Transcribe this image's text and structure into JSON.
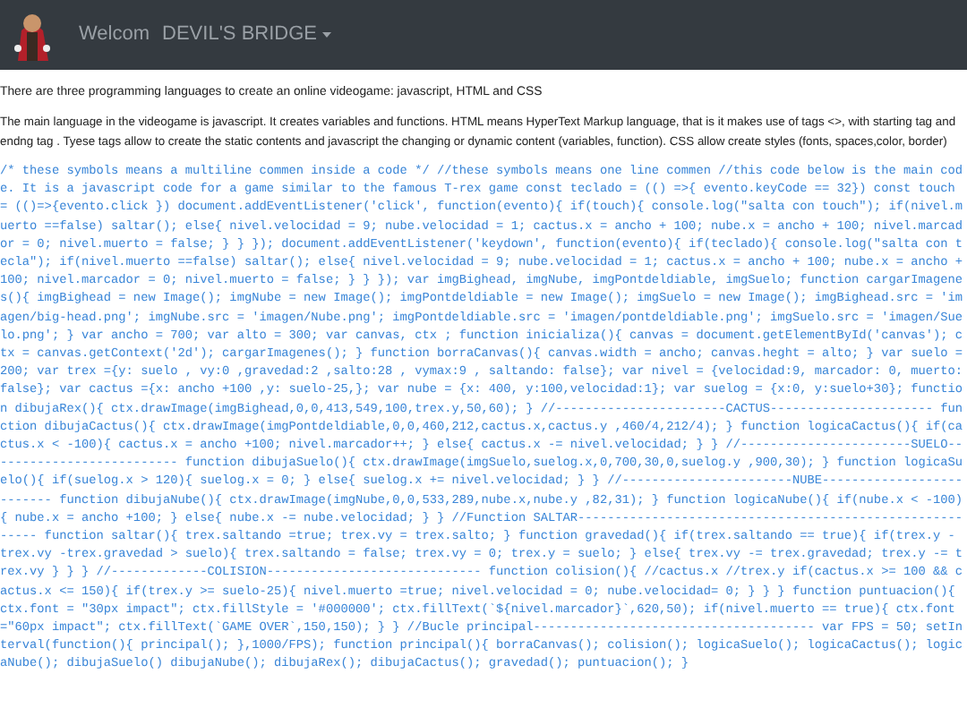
{
  "navbar": {
    "greeting": "Welcom",
    "menu_label": "DEVIL'S BRIDGE"
  },
  "intro": "There are three programming languages to create an online videogame: javascript, HTML and CSS",
  "description": "The main language in the videogame is javascript. It creates variables and functions. HTML means HyperText Markup language, that is it makes use of tags <>, with starting tag and endng tag . Tyese tags allow to create the static contents and javascript the changing or dynamic content (variables, function). CSS allow create styles (fonts, spaces,color, border)",
  "code": "/* these symbols means a multiline commen inside a code */ //these symbols means one line commen //this code below is the main code. It is a javascript code for a game similar to the famous T-rex game const teclado = (() =>{ evento.keyCode == 32}) const touch = (()=>{evento.click }) document.addEventListener('click', function(evento){ if(touch){ console.log(\"salta con touch\"); if(nivel.muerto ==false) saltar(); else{ nivel.velocidad = 9; nube.velocidad = 1; cactus.x = ancho + 100; nube.x = ancho + 100; nivel.marcador = 0; nivel.muerto = false; } } }); document.addEventListener('keydown', function(evento){ if(teclado){ console.log(\"salta con tecla\"); if(nivel.muerto ==false) saltar(); else{ nivel.velocidad = 9; nube.velocidad = 1; cactus.x = ancho + 100; nube.x = ancho + 100; nivel.marcador = 0; nivel.muerto = false; } } }); var imgBighead, imgNube, imgPontdeldiable, imgSuelo; function cargarImagenes(){ imgBighead = new Image(); imgNube = new Image(); imgPontdeldiable = new Image(); imgSuelo = new Image(); imgBighead.src = 'imagen/big-head.png'; imgNube.src = 'imagen/Nube.png'; imgPontdeldiable.src = 'imagen/pontdeldiable.png'; imgSuelo.src = 'imagen/Suelo.png'; } var ancho = 700; var alto = 300; var canvas, ctx ; function inicializa(){ canvas = document.getElementById('canvas'); ctx = canvas.getContext('2d'); cargarImagenes(); } function borraCanvas(){ canvas.width = ancho; canvas.heght = alto; } var suelo =200; var trex ={y: suelo , vy:0 ,gravedad:2 ,salto:28 , vymax:9 , saltando: false}; var nivel = {velocidad:9, marcador: 0, muerto:false}; var cactus ={x: ancho +100 ,y: suelo-25,}; var nube = {x: 400, y:100,velocidad:1}; var suelog = {x:0, y:suelo+30}; function dibujaRex(){ ctx.drawImage(imgBighead,0,0,413,549,100,trex.y,50,60); } //-----------------------CACTUS---------------------- function dibujaCactus(){ ctx.drawImage(imgPontdeldiable,0,0,460,212,cactus.x,cactus.y ,460/4,212/4); } function logicaCactus(){ if(cactus.x < -100){ cactus.x = ancho +100; nivel.marcador++; } else{ cactus.x -= nivel.velocidad; } } //-----------------------SUELO-------------------------- function dibujaSuelo(){ ctx.drawImage(imgSuelo,suelog.x,0,700,30,0,suelog.y ,900,30); } function logicaSuelo(){ if(suelog.x > 120){ suelog.x = 0; } else{ suelog.x += nivel.velocidad; } } //-----------------------NUBE-------------------------- function dibujaNube(){ ctx.drawImage(imgNube,0,0,533,289,nube.x,nube.y ,82,31); } function logicaNube(){ if(nube.x < -100){ nube.x = ancho +100; } else{ nube.x -= nube.velocidad; } } //Function SALTAR--------------------------------------------------------- function saltar(){ trex.saltando =true; trex.vy = trex.salto; } function gravedad(){ if(trex.saltando == true){ if(trex.y - trex.vy -trex.gravedad > suelo){ trex.saltando = false; trex.vy = 0; trex.y = suelo; } else{ trex.vy -= trex.gravedad; trex.y -= trex.vy } } } //-------------COLISION----------------------------- function colision(){ //cactus.x //trex.y if(cactus.x >= 100 && cactus.x <= 150){ if(trex.y >= suelo-25){ nivel.muerto =true; nivel.velocidad = 0; nube.velocidad= 0; } } } function puntuacion(){ ctx.font = \"30px impact\"; ctx.fillStyle = '#000000'; ctx.fillText(`${nivel.marcador}`,620,50); if(nivel.muerto == true){ ctx.font =\"60px impact\"; ctx.fillText(`GAME OVER`,150,150); } } //Bucle principal-------------------------------------- var FPS = 50; setInterval(function(){ principal(); },1000/FPS); function principal(){ borraCanvas(); colision(); logicaSuelo(); logicaCactus(); logicaNube(); dibujaSuelo() dibujaNube(); dibujaRex(); dibujaCactus(); gravedad(); puntuacion(); }"
}
